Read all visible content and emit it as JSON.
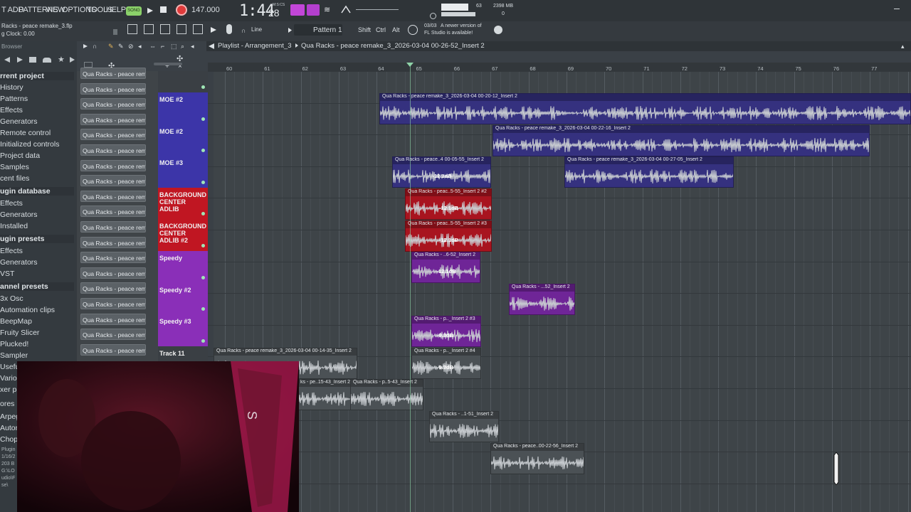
{
  "menu": [
    "T ADD",
    "PATTERNS",
    "VIEW",
    "OPTIONS",
    "TOOLS",
    "HELP"
  ],
  "transport": {
    "song_label": "SONG",
    "tempo": "147.000",
    "time": "1:44",
    "time_sub": "28",
    "time_unit": "M:S:CS",
    "cpu": "63",
    "ram": "2398 MB",
    "ram_sub": "0"
  },
  "project": {
    "file": "Racks - peace remake_3.flp",
    "clock": "g Clock: 0.00"
  },
  "toolbar2": {
    "snap": "Line",
    "pattern": "Pattern 1",
    "shift": "Shift",
    "ctrl": "Ctrl",
    "alt": "Alt",
    "notice_date": "03/03",
    "notice_text_1": "A newer version of",
    "notice_text_2": "FL Studio is available!"
  },
  "browser": {
    "title": "Browser",
    "items": [
      {
        "label": "rrent project",
        "head": true
      },
      {
        "label": "History"
      },
      {
        "label": "Patterns"
      },
      {
        "label": "Effects"
      },
      {
        "label": "Generators"
      },
      {
        "label": "Remote control"
      },
      {
        "label": "Initialized controls"
      },
      {
        "label": "Project data"
      },
      {
        "label": "Samples"
      },
      {
        "label": "cent files"
      },
      {
        "label": "ugin database",
        "head": true
      },
      {
        "label": "Effects"
      },
      {
        "label": "Generators"
      },
      {
        "label": "Installed"
      },
      {
        "label": "ugin presets",
        "head": true
      },
      {
        "label": "Effects"
      },
      {
        "label": "Generators"
      },
      {
        "label": "VST"
      },
      {
        "label": "annel presets",
        "head": true
      },
      {
        "label": "3x Osc"
      },
      {
        "label": "Automation clips"
      },
      {
        "label": "BeepMap"
      },
      {
        "label": "Fruity Slicer"
      },
      {
        "label": "Plucked!"
      },
      {
        "label": "Sampler"
      },
      {
        "label": "Usefu"
      },
      {
        "label": "Vario"
      },
      {
        "label": "xer p"
      },
      {
        "label": "ores"
      },
      {
        "label": "Arpeg"
      },
      {
        "label": "Autom"
      },
      {
        "label": "Chopp"
      }
    ],
    "footer": [
      "Plugin",
      "1/16/2",
      "203 B",
      "G:\\LO",
      "udio\\F",
      "se\\"
    ]
  },
  "playlist": {
    "title": "Playlist - Arrangement_3",
    "breadcrumb": "Qua Racks - peace remake_3_2026-03-04 00-26-52_Insert 2",
    "ruler": [
      "60",
      "61",
      "62",
      "63",
      "64",
      "65",
      "66",
      "67",
      "68",
      "69",
      "70",
      "71",
      "72",
      "73",
      "74",
      "75",
      "76",
      "77"
    ]
  },
  "rack_label": "Qua Racks - peace remak",
  "tracks": [
    {
      "name": "",
      "color": "#3a3f44"
    },
    {
      "name": "MOE #2",
      "color": "#3c35a8"
    },
    {
      "name": "MOE #2",
      "color": "#3c35a8"
    },
    {
      "name": "MOE #3",
      "color": "#3c35a8"
    },
    {
      "name": "BACKGROUND CENTER ADLIB",
      "color": "#c01622"
    },
    {
      "name": "BACKGROUND CENTER ADLIB #2",
      "color": "#c01622"
    },
    {
      "name": "Speedy",
      "color": "#8a2fb8"
    },
    {
      "name": "Speedy #2",
      "color": "#8a2fb8"
    },
    {
      "name": "Speedy #3",
      "color": "#8a2fb8"
    },
    {
      "name": "Track 11",
      "color": "#3a3f44"
    }
  ],
  "clips": [
    {
      "row": 1,
      "title": "Qua Racks - peace remake_3_2026-03-04 00-20-12_Insert 2",
      "color": "#35317f",
      "db": ""
    },
    {
      "row": 2,
      "title": "Qua Racks - peace remake_3_2026-03-04 00-22-16_Insert 2",
      "color": "#35317f",
      "db": ""
    },
    {
      "row": 3,
      "title": "Qua Racks - peace..4 00-05-55_Insert 2",
      "color": "#35317f",
      "db": "-12.1dB"
    },
    {
      "row": 3,
      "title": "Qua Racks - peace remake_3_2026-03-04 00-27-05_Insert 2",
      "color": "#35317f",
      "db": ""
    },
    {
      "row": 4,
      "title": "Qua Racks - peac..5-55_Insert 2 #2",
      "color": "#a8141f",
      "db": "-12.1dB"
    },
    {
      "row": 5,
      "title": "Qua Racks - peac..5-55_Insert 2 #3",
      "color": "#a8141f",
      "db": "-12.1dB"
    },
    {
      "row": 6,
      "title": "Qua Racks - ..6-52_Insert 2",
      "color": "#6f2597",
      "db": "-12.1dB"
    },
    {
      "row": 7,
      "title": "Qua Racks - ...52_Insert 2",
      "color": "#6f2597",
      "db": ""
    },
    {
      "row": 8,
      "title": "Qua Racks - p.._Insert 2 #3",
      "color": "#6f2597",
      "db": "-9.3dB"
    },
    {
      "row": 9,
      "title": "Qua Racks - peace remake_3_2026-03-04 00-14-35_Insert 2",
      "color": "#4b5155",
      "db": ""
    },
    {
      "row": 9,
      "title": "Qua Racks - p.._Insert 2 #4",
      "color": "#4b5155",
      "db": "-9.3dB"
    },
    {
      "row": 10,
      "title": "ks - pe..15-43_Insert 2",
      "color": "#4b5155",
      "db": ""
    },
    {
      "row": 10,
      "title": "Qua Racks - p..5-43_Insert 2",
      "color": "#4b5155",
      "db": ""
    },
    {
      "row": 11,
      "title": "Qua Racks - ..1-51_Insert 2",
      "color": "#4b5155",
      "db": ""
    },
    {
      "row": 12,
      "title": "Qua Racks - peace..00-22-56_Insert 2",
      "color": "#4b5155",
      "db": ""
    }
  ],
  "colors": {
    "accent": "#e03b3b",
    "playhead": "#8fd3a8",
    "song_toggle": "#8bd16a"
  }
}
